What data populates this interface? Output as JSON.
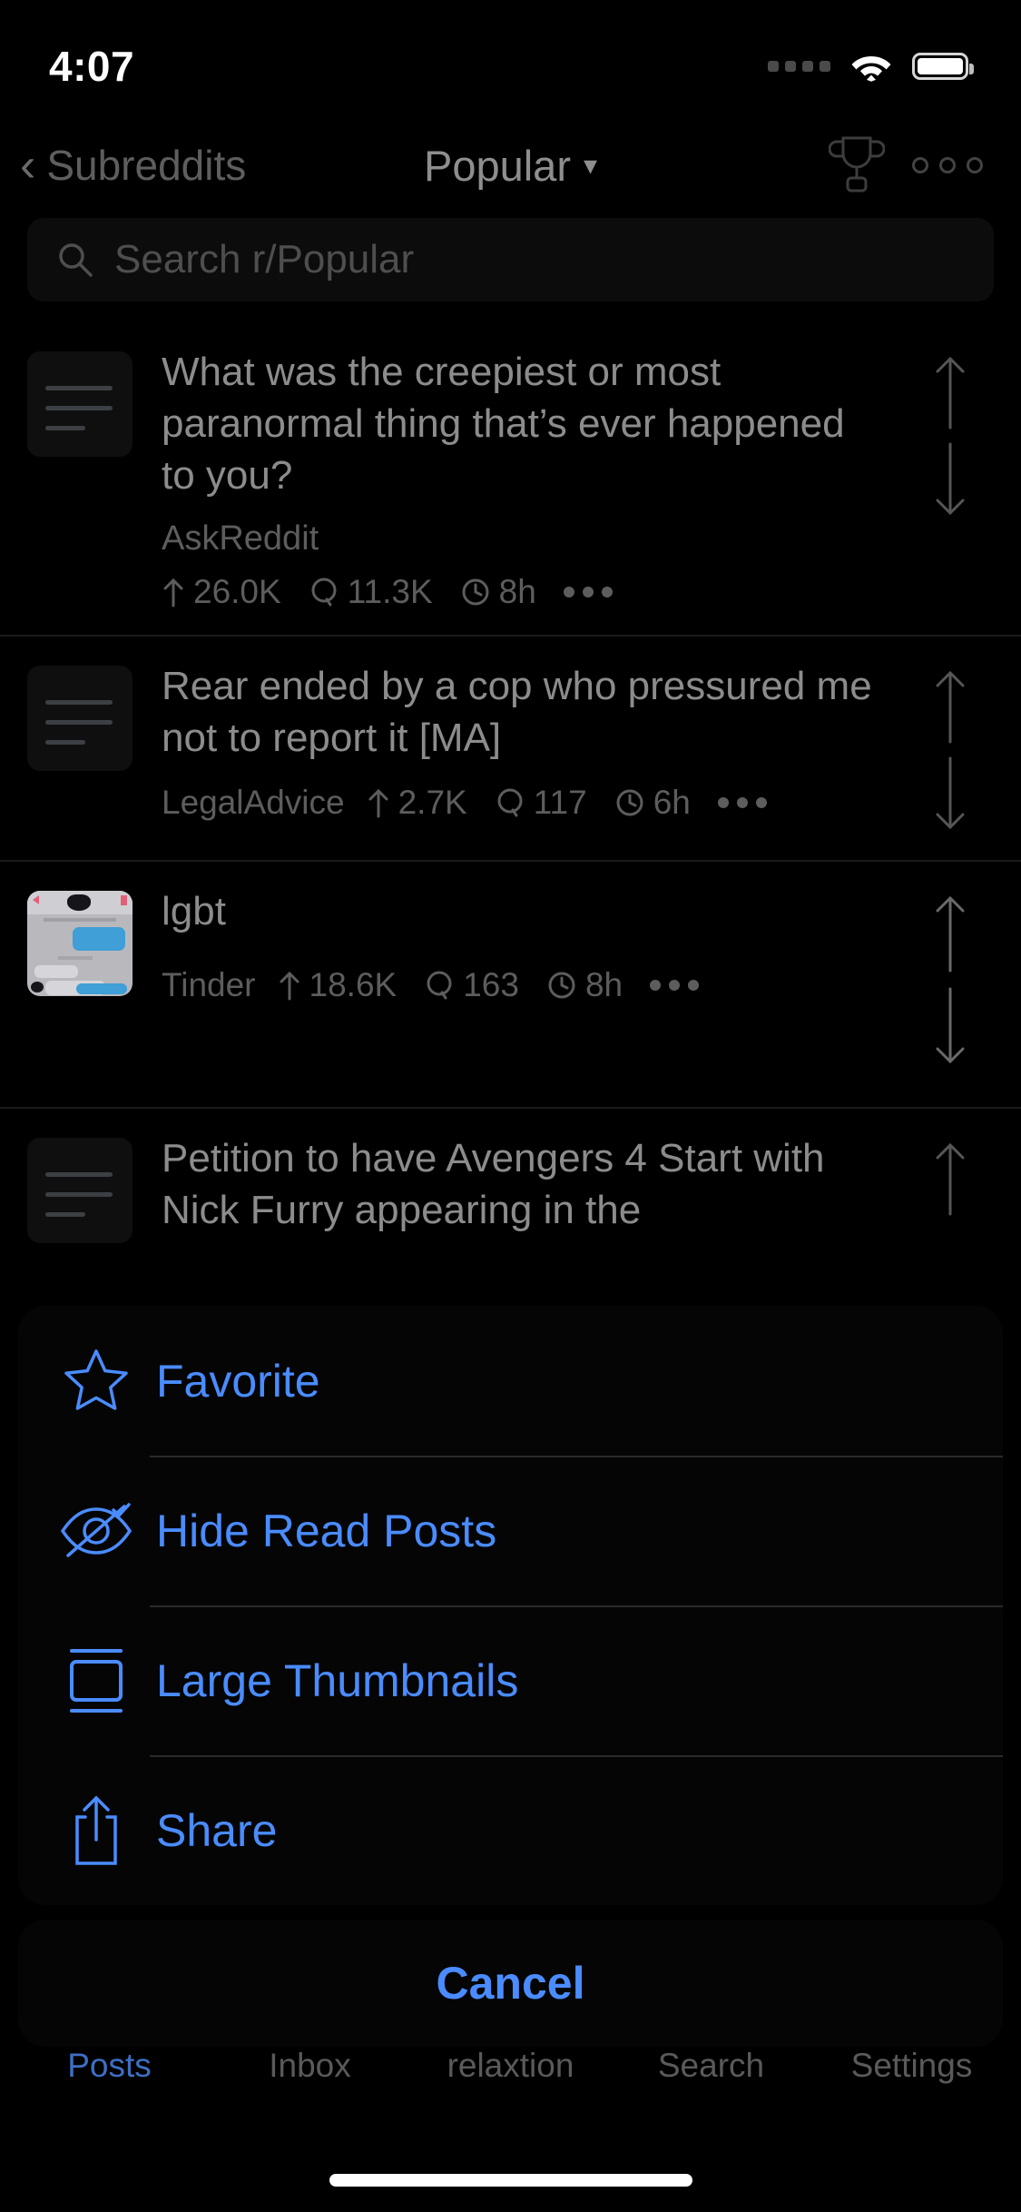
{
  "status_bar": {
    "time": "4:07",
    "signal_icon": "signal-dots-icon",
    "wifi_icon": "wifi-icon",
    "battery_icon": "battery-full-icon"
  },
  "nav_bar": {
    "back_label": "Subreddits",
    "back_icon": "chevron-left-icon",
    "title": "Popular",
    "title_chevron": "chevron-down-icon",
    "trophy_icon": "trophy-icon",
    "overflow_icon": "more-horizontal-icon"
  },
  "search": {
    "placeholder": "Search r/Popular",
    "value": "",
    "icon": "search-icon"
  },
  "feed": {
    "posts": [
      {
        "title": "What was the creepiest or most paranormal thing that’s ever happened to you?",
        "subreddit": "AskReddit",
        "upvotes": "26.0K",
        "comments": "11.3K",
        "age": "8h",
        "thumbnail": "text-post-icon",
        "layout": "stacked",
        "upvote_icon": "arrow-up-icon",
        "downvote_icon": "arrow-down-icon",
        "comment_icon": "comment-icon",
        "clock_icon": "clock-icon",
        "overflow_icon": "more-horizontal-icon"
      },
      {
        "title": "Rear ended by a cop who pressured me not to report it [MA]",
        "subreddit": "LegalAdvice",
        "upvotes": "2.7K",
        "comments": "117",
        "age": "6h",
        "thumbnail": "text-post-icon",
        "layout": "inline",
        "upvote_icon": "arrow-up-icon",
        "downvote_icon": "arrow-down-icon",
        "comment_icon": "comment-icon",
        "clock_icon": "clock-icon",
        "overflow_icon": "more-horizontal-icon"
      },
      {
        "title": "lgbt",
        "subreddit": "Tinder",
        "upvotes": "18.6K",
        "comments": "163",
        "age": "8h",
        "thumbnail": "chat-screenshot-image",
        "layout": "inline",
        "upvote_icon": "arrow-up-icon",
        "downvote_icon": "arrow-down-icon",
        "comment_icon": "comment-icon",
        "clock_icon": "clock-icon",
        "overflow_icon": "more-horizontal-icon"
      },
      {
        "title": "Petition to have Avengers 4 Start with Nick Furry appearing in the",
        "subreddit": "",
        "upvotes": "",
        "comments": "",
        "age": "",
        "thumbnail": "text-post-icon",
        "layout": "truncated",
        "upvote_icon": "arrow-up-icon",
        "downvote_icon": "arrow-down-icon",
        "comment_icon": "comment-icon",
        "clock_icon": "clock-icon",
        "overflow_icon": "more-horizontal-icon"
      }
    ]
  },
  "action_sheet": {
    "accent_color": "#4a8cff",
    "items": [
      {
        "label": "Favorite",
        "icon": "star-icon"
      },
      {
        "label": "Hide Read Posts",
        "icon": "eye-slash-icon"
      },
      {
        "label": "Large Thumbnails",
        "icon": "large-thumbnail-icon"
      },
      {
        "label": "Share",
        "icon": "share-icon"
      }
    ],
    "cancel_label": "Cancel"
  },
  "tab_bar": {
    "active_color": "#3d6fc4",
    "tabs": [
      {
        "label": "Posts",
        "active": true
      },
      {
        "label": "Inbox",
        "active": false
      },
      {
        "label": "relaxtion",
        "active": false
      },
      {
        "label": "Search",
        "active": false
      },
      {
        "label": "Settings",
        "active": false
      }
    ]
  }
}
